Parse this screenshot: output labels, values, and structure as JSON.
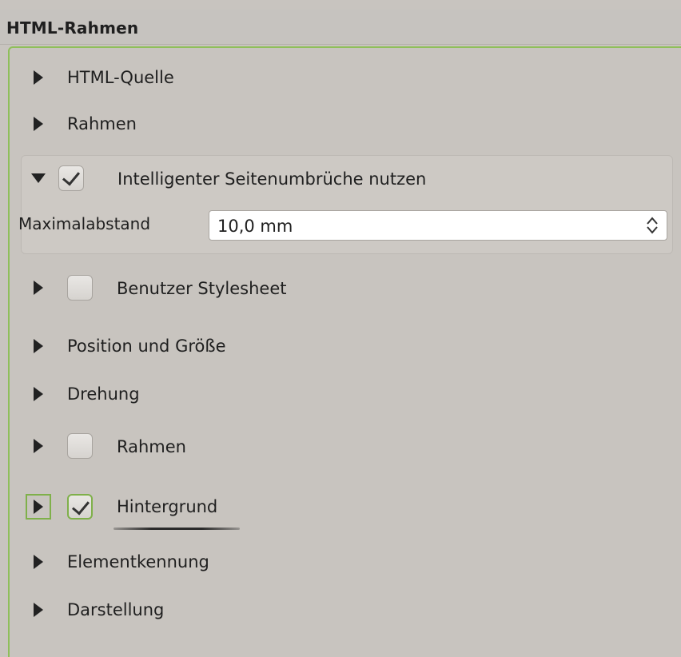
{
  "header": {
    "title": "HTML-Rahmen"
  },
  "sections": {
    "html_source": {
      "label": "HTML-Quelle"
    },
    "frame": {
      "label": "Rahmen"
    },
    "smart_breaks": {
      "label": "Intelligenter Seitenumbrüche nutzen",
      "checked": true,
      "expanded": true,
      "max_distance": {
        "label": "Maximalabstand",
        "value": "10,0 mm"
      }
    },
    "user_stylesheet": {
      "label": "Benutzer Stylesheet",
      "checked": false
    },
    "position_size": {
      "label": "Position und Größe"
    },
    "rotation": {
      "label": "Drehung"
    },
    "frame_checkable": {
      "label": "Rahmen",
      "checked": false
    },
    "background": {
      "label": "Hintergrund",
      "checked": true
    },
    "item_id": {
      "label": "Elementkennung"
    },
    "rendering": {
      "label": "Darstellung"
    }
  },
  "colors": {
    "accent": "#8fbf5a",
    "background": "#c8c4bf"
  }
}
